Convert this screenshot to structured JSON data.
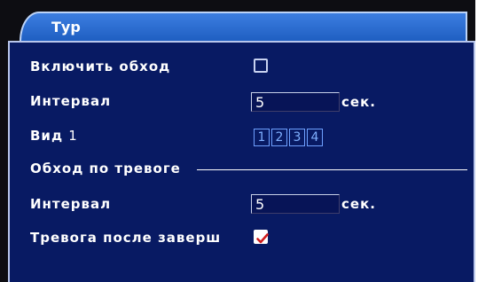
{
  "title": "Тур",
  "enable_tour": {
    "label": "Включить обход",
    "checked": false
  },
  "interval": {
    "label": "Интервал",
    "value": "5",
    "unit": "сек."
  },
  "view": {
    "label": "Вид",
    "value": "1",
    "channels": [
      "1",
      "2",
      "3",
      "4"
    ]
  },
  "alarm_section": {
    "label": "Обход по тревоге"
  },
  "alarm_interval": {
    "label": "Интервал",
    "value": "5",
    "unit": "сек."
  },
  "alarm_after_end": {
    "label": "Тревога после заверш",
    "checked": true
  },
  "colors": {
    "panel": "#081a63",
    "title_tab": "#2a6bd2",
    "text": "#ffffff",
    "channel_box": "#6ea0ff",
    "check_mark": "#d01c1c"
  }
}
